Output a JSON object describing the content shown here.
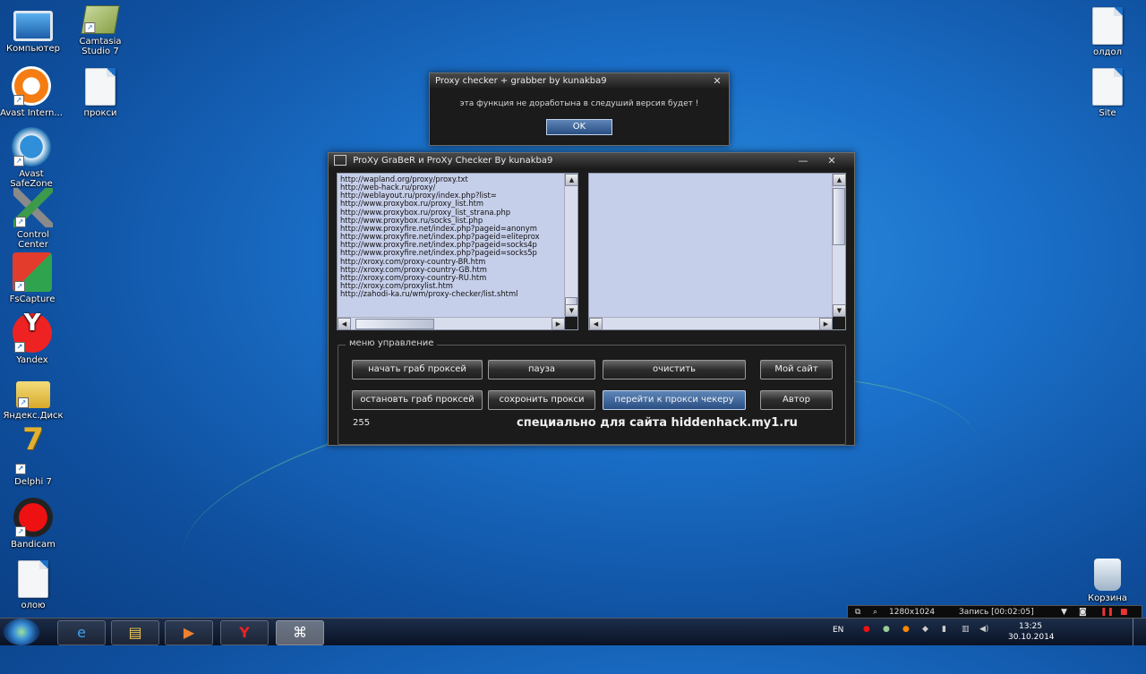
{
  "desktop": {
    "left_icons": [
      {
        "label": "Компьютер",
        "icon": "computer-icon"
      },
      {
        "label": "Avast Intern...",
        "icon": "avast-icon"
      },
      {
        "label": "Avast SafeZone",
        "icon": "avast-safezone-icon"
      },
      {
        "label": "Control Center",
        "icon": "control-center-icon"
      },
      {
        "label": "FsCapture",
        "icon": "fscapture-icon"
      },
      {
        "label": "Yandex",
        "icon": "yandex-icon"
      },
      {
        "label": "Яндекс.Диск",
        "icon": "yandex-disk-icon"
      },
      {
        "label": "Delphi 7",
        "icon": "delphi-icon"
      },
      {
        "label": "Bandicam",
        "icon": "bandicam-icon"
      },
      {
        "label": "олою",
        "icon": "file-icon"
      }
    ],
    "second_col_icons": [
      {
        "label": "Camtasia Studio 7",
        "icon": "camtasia-icon"
      },
      {
        "label": "прокси",
        "icon": "file-icon"
      }
    ],
    "right_icons": [
      {
        "label": "олдол",
        "icon": "file-icon"
      },
      {
        "label": "Site",
        "icon": "file-icon"
      },
      {
        "label": "Корзина",
        "icon": "recycle-bin-icon"
      }
    ]
  },
  "message_box": {
    "title": "Proxy checker + grabber by kunakba9",
    "close": "✕",
    "text": "эта функция не доработына в следуший версия будет !",
    "ok_label": "OK"
  },
  "app": {
    "title": "ProXy GraBeR и ProXy Checker By kunakba9",
    "minimize": "—",
    "close": "✕",
    "proxy_sources": [
      "http://wapland.org/proxy/proxy.txt",
      "http://web-hack.ru/proxy/",
      "http://weblayout.ru/proxy/index.php?list=",
      "http://www.proxybox.ru/proxy_list.htm",
      "http://www.proxybox.ru/proxy_list_strana.php",
      "http://www.proxybox.ru/socks_list.php",
      "http://www.proxyfire.net/index.php?pageid=anonym",
      "http://www.proxyfire.net/index.php?pageid=eliteprox",
      "http://www.proxyfire.net/index.php?pageid=socks4p",
      "http://www.proxyfire.net/index.php?pageid=socks5p",
      "http://xroxy.com/proxy-country-BR.htm",
      "http://xroxy.com/proxy-country-GB.htm",
      "http://xroxy.com/proxy-country-RU.htm",
      "http://xroxy.com/proxylist.htm",
      "http://zahodi-ka.ru/wm/proxy-checker/list.shtml"
    ],
    "group_label": "меню управление",
    "buttons": {
      "start_grab": "начать граб проксей",
      "pause": "пауза",
      "clear": "очистить",
      "my_site": "Мой сайт",
      "stop_grab": "остановть граб проксей",
      "save_proxy": "сохронить прокси",
      "go_checker": "перейти к прокси чекеру",
      "author": "Автор"
    },
    "count": "255",
    "promo": "специально для сайта hiddenhack.my1.ru"
  },
  "recorder": {
    "resolution": "1280x1024",
    "status": "Запись [00:02:05]"
  },
  "taskbar": {
    "language": "EN",
    "time": "13:25",
    "date": "30.10.2014",
    "active_app_glyph": "⌘"
  },
  "colors": {
    "window_bg": "#1b1b1b",
    "listbox_bg": "#c6cfea",
    "highlight_button": "#2a4e82",
    "desktop_bg": "#1a6fc8"
  }
}
